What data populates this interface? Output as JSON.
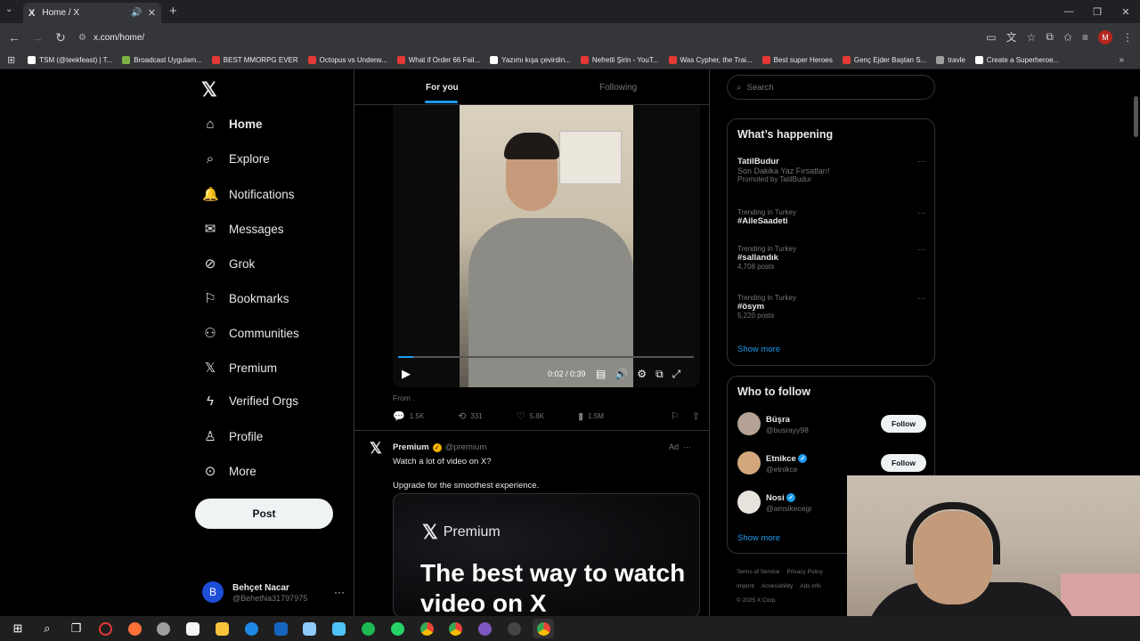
{
  "browser": {
    "tab_title": "Home / X",
    "tab_icon": "X",
    "url": "x.com/home/",
    "profile_initial": "M",
    "bookmarks": [
      {
        "label": "TSM (@teekfeast) | T...",
        "color": "#ffffff"
      },
      {
        "label": "Broadcast Uygulam...",
        "color": "#7cb342"
      },
      {
        "label": "BEST MMORPG EVER",
        "color": "#e53935"
      },
      {
        "label": "Octopus vs Underw...",
        "color": "#e53935"
      },
      {
        "label": "What if Order 66 Fail...",
        "color": "#e53935"
      },
      {
        "label": "Yazımı kışa çevirdin...",
        "color": "#ffffff"
      },
      {
        "label": "Nefretli Şirin - YouT...",
        "color": "#e53935"
      },
      {
        "label": "Was Cypher, the Trai...",
        "color": "#e53935"
      },
      {
        "label": "Best super Heroes",
        "color": "#e53935"
      },
      {
        "label": "Genç Ejder Baştan S...",
        "color": "#e53935"
      },
      {
        "label": "travle",
        "color": "#9e9e9e"
      },
      {
        "label": "Create a Superheroe...",
        "color": "#ffffff"
      }
    ]
  },
  "nav": {
    "logo": "𝕏",
    "items": [
      {
        "label": "Home",
        "icon": "home-icon",
        "glyph": "⌂"
      },
      {
        "label": "Explore",
        "icon": "search-icon",
        "glyph": "⌕"
      },
      {
        "label": "Notifications",
        "icon": "bell-icon",
        "glyph": "🔔"
      },
      {
        "label": "Messages",
        "icon": "envelope-icon",
        "glyph": "✉"
      },
      {
        "label": "Grok",
        "icon": "grok-icon",
        "glyph": "⊘"
      },
      {
        "label": "Bookmarks",
        "icon": "bookmark-icon",
        "glyph": "⚐"
      },
      {
        "label": "Communities",
        "icon": "communities-icon",
        "glyph": "⚇"
      },
      {
        "label": "Premium",
        "icon": "x-icon",
        "glyph": "𝕏"
      },
      {
        "label": "Verified Orgs",
        "icon": "lightning-icon",
        "glyph": "ϟ"
      },
      {
        "label": "Profile",
        "icon": "person-icon",
        "glyph": "♙"
      },
      {
        "label": "More",
        "icon": "more-circle-icon",
        "glyph": "⊙"
      }
    ],
    "post_label": "Post",
    "account": {
      "initial": "B",
      "name": "Behçet Nacar",
      "handle": "@BehetNa31797975"
    }
  },
  "feed": {
    "tabs": {
      "for_you": "For you",
      "following": "Following"
    },
    "video": {
      "time": "0:02 / 0:39",
      "progress": 0.05
    },
    "from_text": "From .",
    "actions": {
      "replies": "1.5K",
      "reposts": "331",
      "likes": "5.8K",
      "views": "1.5M"
    },
    "ad": {
      "name": "Premium",
      "handle": "@premium",
      "ad_label": "Ad",
      "text1": "Watch a lot of video on X?",
      "text2": "Upgrade for the smoothest experience.",
      "promo_brand": "Premium",
      "promo_headline": "The best way to watch video on X"
    }
  },
  "sidebar": {
    "search_placeholder": "Search",
    "happening_title": "What’s happening",
    "trends": [
      {
        "top": "",
        "tag": "TatilBudur",
        "subtext": "Son Dakika Yaz Fırsatları!",
        "sub": "Promoted by TatilBudur"
      },
      {
        "top": "Trending in Turkey",
        "tag": "#AileSaadeti",
        "subtext": "",
        "sub": ""
      },
      {
        "top": "Trending in Turkey",
        "tag": "#sallandık",
        "subtext": "",
        "sub": "4,708 posts"
      },
      {
        "top": "Trending in Turkey",
        "tag": "#ösym",
        "subtext": "",
        "sub": "5,220 posts"
      }
    ],
    "show_more": "Show more",
    "who_title": "Who to follow",
    "who": [
      {
        "name": "Büşra",
        "handle": "@busrayy98",
        "verified": false,
        "follow": "Follow",
        "color": "#b5a294"
      },
      {
        "name": "Etnikce",
        "handle": "@etnikce",
        "verified": true,
        "follow": "Follow",
        "color": "#d2a77c"
      },
      {
        "name": "Nosi",
        "handle": "@amsikecegi",
        "verified": true,
        "follow": "",
        "color": "#e8e2dc"
      }
    ],
    "show_more2": "Show more",
    "footer": [
      "Terms of Service",
      "Privacy Policy",
      "Imprint",
      "Accessibility",
      "Ads info",
      "© 2025 X Corp."
    ]
  }
}
